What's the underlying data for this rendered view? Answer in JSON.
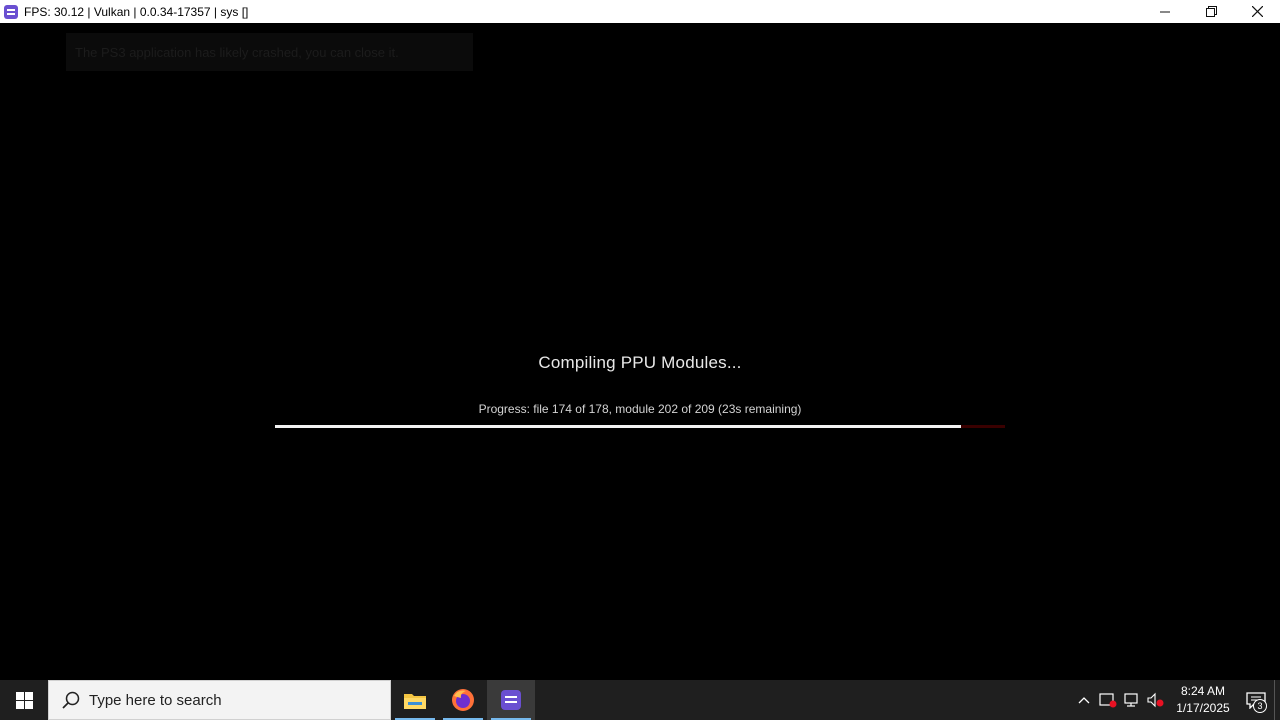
{
  "window": {
    "title": "FPS: 30.12 | Vulkan | 0.0.34-17357 | sys []"
  },
  "game": {
    "crash_notice": "The PS3 application has likely crashed, you can close it.",
    "compile_title": "Compiling PPU Modules...",
    "progress_text": "Progress: file 174 of 178, module 202 of 209 (23s remaining)",
    "progress_fraction": 0.94
  },
  "taskbar": {
    "search_placeholder": "Type here to search",
    "apps": [
      "file-explorer-icon",
      "firefox-icon",
      "rpcs3-icon"
    ],
    "clock_time": "8:24 AM",
    "clock_date": "1/17/2025",
    "notification_count": "3"
  },
  "colors": {
    "accent": "#6a4fd1",
    "taskbar": "#1f1f1f",
    "progress_fill": "#f2f2f2",
    "progress_track": "#3a0000"
  }
}
